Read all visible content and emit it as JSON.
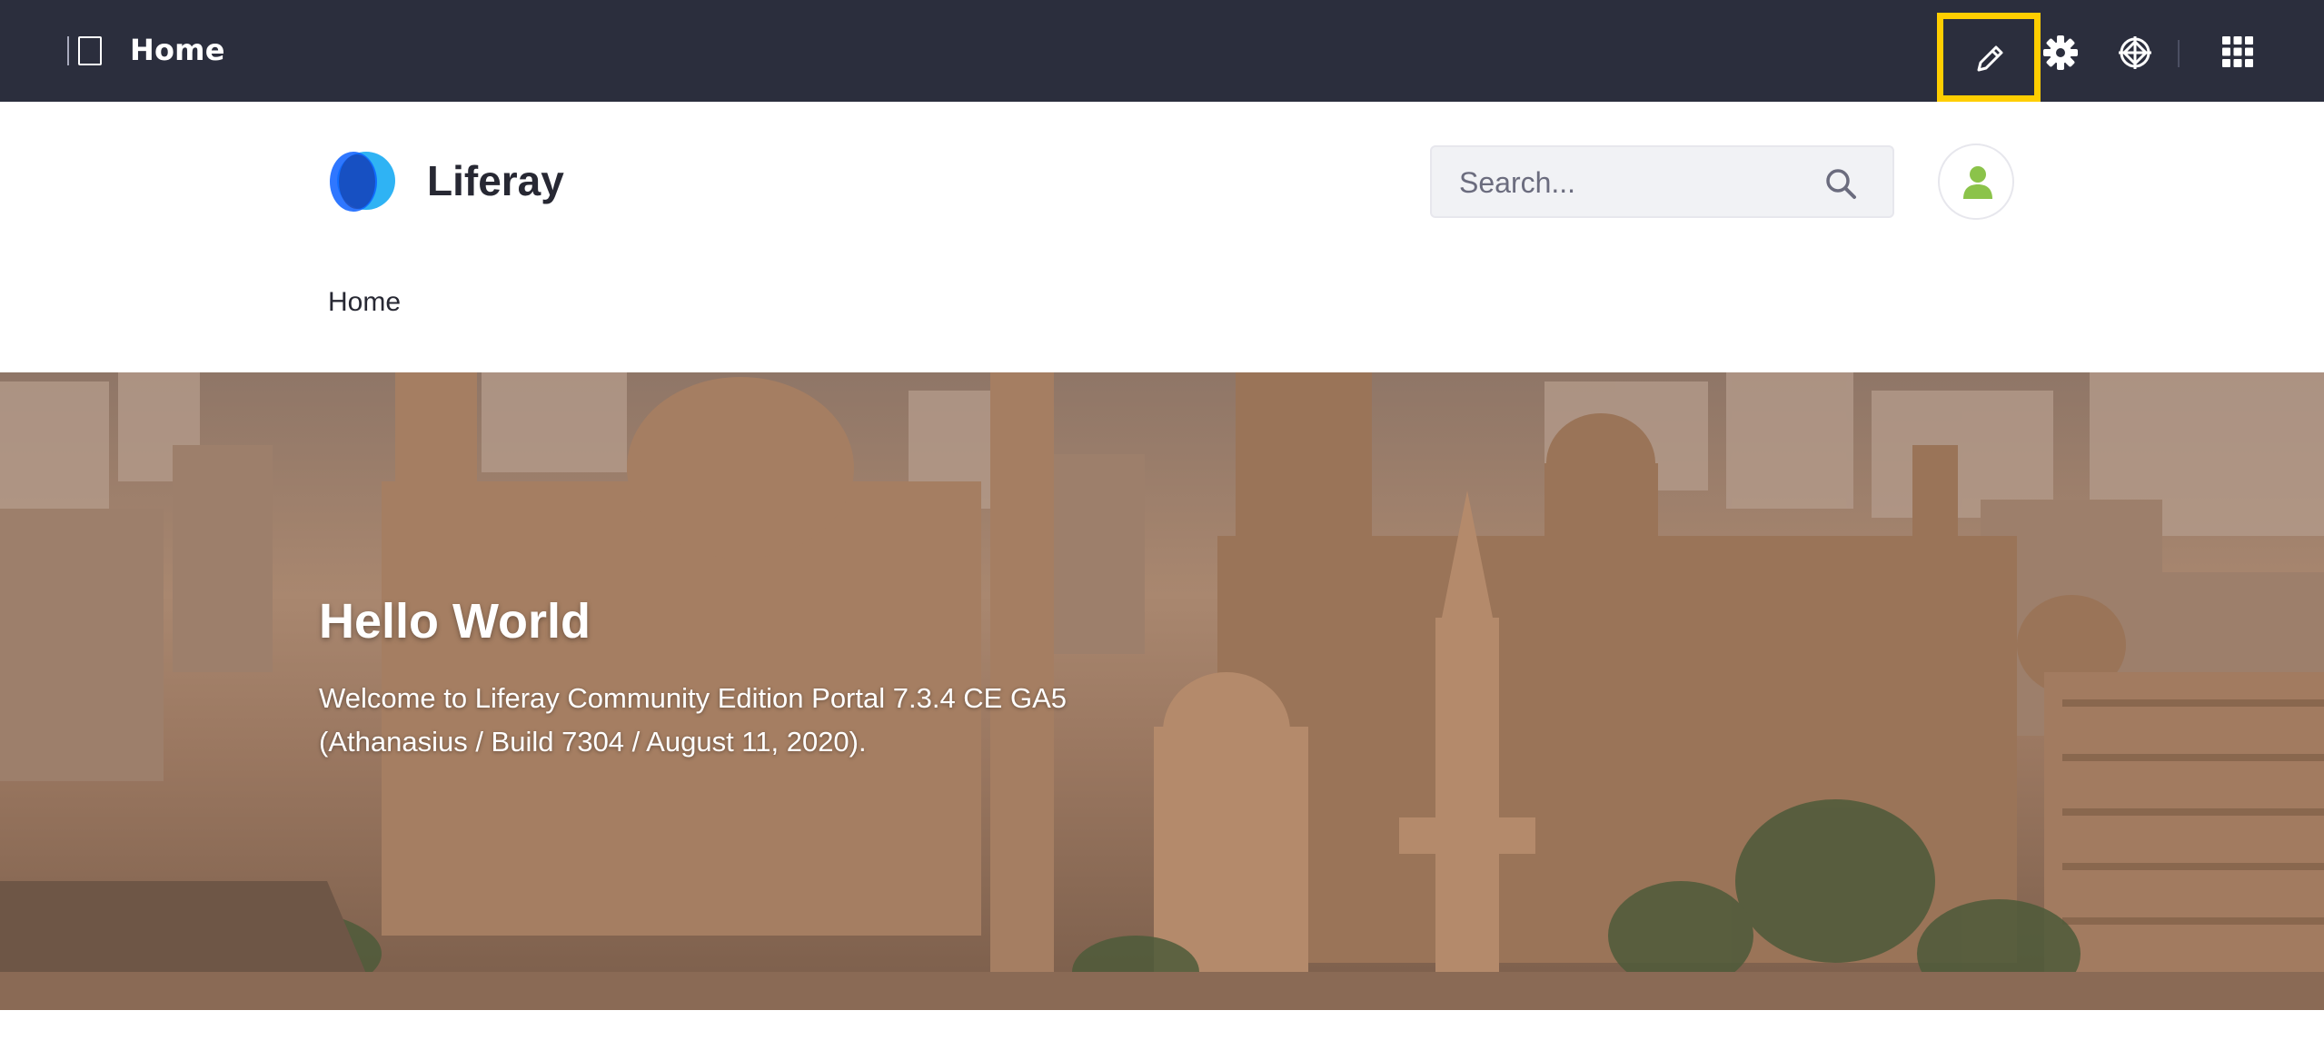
{
  "control_menu": {
    "title": "Home",
    "sidebar_toggle_icon": "product-menu-icon",
    "actions": [
      {
        "name": "edit",
        "icon": "pencil-icon",
        "highlighted": true,
        "highlight_color": "#ffce00"
      },
      {
        "name": "configure",
        "icon": "gear-icon"
      },
      {
        "name": "simulation",
        "icon": "simulation-target-icon"
      },
      {
        "name": "applications",
        "icon": "grid-apps-icon"
      }
    ],
    "background": "#2b2e3d"
  },
  "site_header": {
    "site_name": "Liferay",
    "logo_icon": "liferay-logo",
    "search": {
      "placeholder": "Search..."
    },
    "user_icon": "user-avatar-icon",
    "user_icon_color": "#8bc34a"
  },
  "navigation": {
    "items": [
      {
        "label": "Home"
      }
    ]
  },
  "banner": {
    "title": "Hello World",
    "text_line1": "Welcome to Liferay Community Edition Portal 7.3.4 CE GA5",
    "text_line2": "(Athanasius / Build 7304 / August 11, 2020)."
  }
}
